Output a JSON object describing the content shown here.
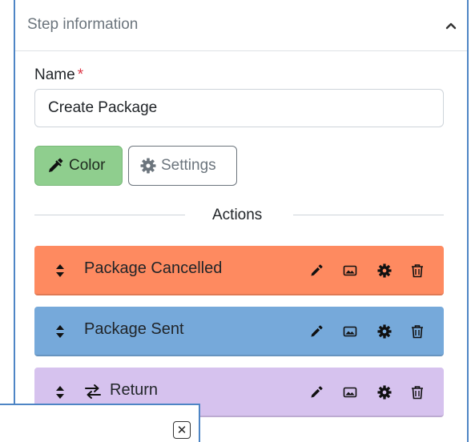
{
  "panel": {
    "title": "Step information",
    "name_label": "Name",
    "required_mark": "*",
    "name_value": "Create Package",
    "color_button": "Color",
    "settings_button": "Settings",
    "actions_header": "Actions"
  },
  "actions": [
    {
      "label": "Package Cancelled",
      "color": "#fe8a60"
    },
    {
      "label": "Package Sent",
      "color": "#76a9da"
    },
    {
      "label": "Return",
      "color": "#d6c2ee"
    }
  ],
  "tooltip": {
    "close_glyph": "✕"
  }
}
